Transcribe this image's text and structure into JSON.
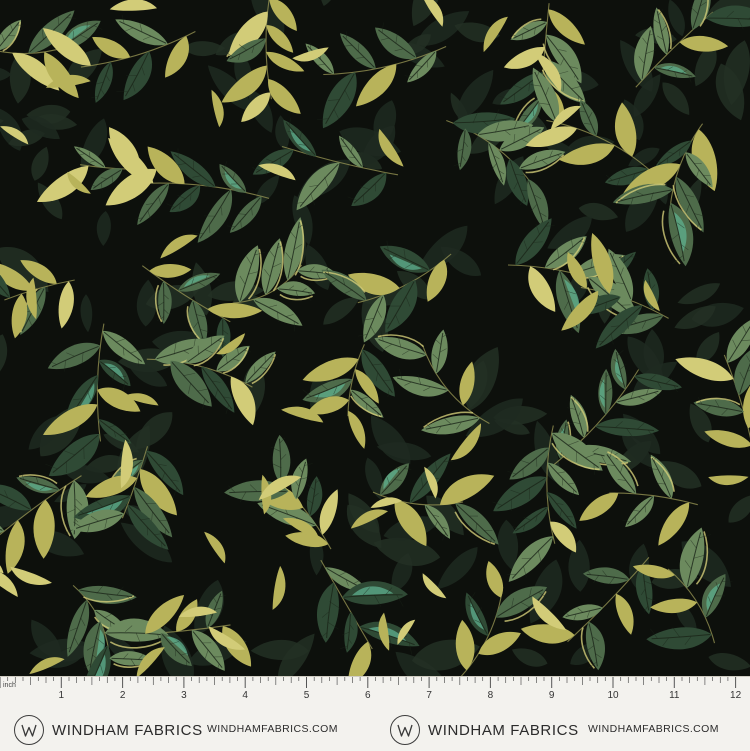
{
  "fabric": {
    "background_color": "#0d100c",
    "palette": {
      "shadow_leaf": "#1f2a21",
      "dark_leaf": "#2f4a35",
      "mid_leaf": "#4e6b4a",
      "light_leaf": "#6c8a5e",
      "teal_accent": "#5fb08f",
      "gold_leaf": "#b8b35a",
      "pale_gold": "#d2cc78",
      "vein": "#1a2418",
      "stem": "#9c9a55"
    }
  },
  "ruler": {
    "unit_label": "inch",
    "numbers": [
      "1",
      "2",
      "3",
      "4",
      "5",
      "6",
      "7",
      "8",
      "9",
      "10",
      "11",
      "12"
    ],
    "background_color": "#f3f2ee",
    "brand_blocks": [
      {
        "logo_letter": "W",
        "name": "WINDHAM FABRICS"
      },
      {
        "logo_letter": "W",
        "name": "WINDHAM FABRICS"
      }
    ],
    "site_urls": [
      "WINDHAMFABRICS.COM",
      "WINDHAMFABRICS.COM"
    ]
  }
}
